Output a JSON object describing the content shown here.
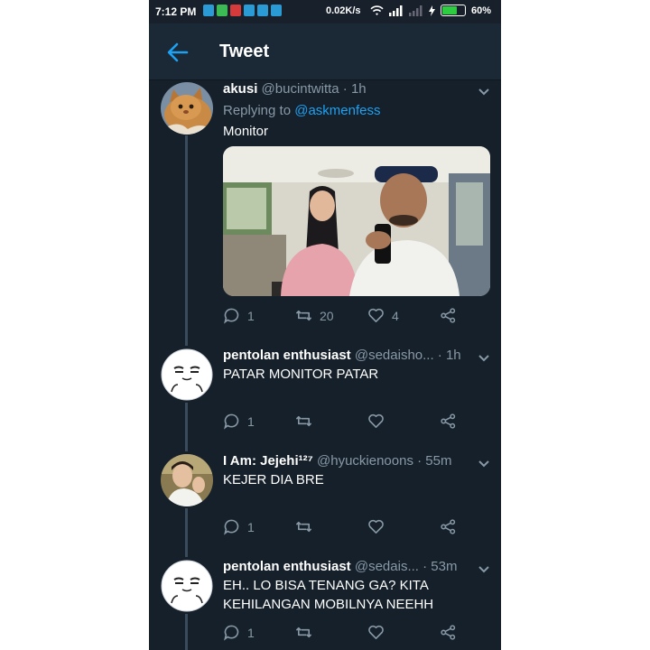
{
  "status_bar": {
    "time": "7:12 PM",
    "speed": "0.02K/s",
    "battery_text": "60%",
    "battery_level": 0.6,
    "app_icon_colors": [
      "#2b9bd6",
      "#3cba54",
      "#d63b3b",
      "#2b9bd6",
      "#2b9bd6",
      "#2b9bd6"
    ]
  },
  "header": {
    "title": "Tweet",
    "back_icon": "arrow-left-icon"
  },
  "colors": {
    "background": "#15202b",
    "accent": "#1da1f2",
    "muted": "#8899a6"
  },
  "tweets": [
    {
      "name": "akusi",
      "handle": "@bucintwitta · 1h",
      "replying_prefix": "Replying to",
      "replying_to": "@askmenfess",
      "text": "Monitor",
      "media": "photo",
      "replies": "1",
      "retweets": "20",
      "likes": "4"
    },
    {
      "name": "pentolan enthusiast",
      "handle": "@sedaisho... · 1h",
      "text": "PATAR MONITOR PATAR",
      "replies": "1",
      "retweets": "",
      "likes": ""
    },
    {
      "name": "I Am: Jejehi¹²⁷",
      "handle": "@hyuckienoons · 55m",
      "text": "KEJER DIA BRE",
      "replies": "1",
      "retweets": "",
      "likes": ""
    },
    {
      "name": "pentolan enthusiast",
      "handle": "@sedais... · 53m",
      "text": "EH..  LO BISA TENANG GA? KITA KEHILANGAN MOBILNYA NEEHH",
      "replies": "1",
      "retweets": "",
      "likes": ""
    }
  ]
}
